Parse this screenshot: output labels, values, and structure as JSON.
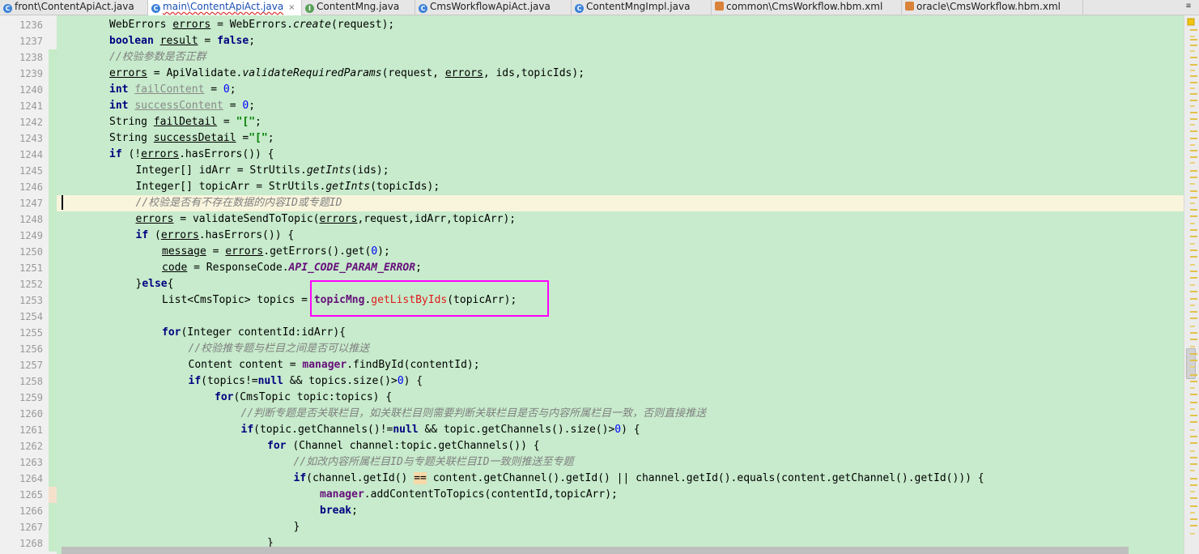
{
  "tabs": [
    {
      "label": "front\\ContentApiAct.java",
      "icon": "java-class-icon",
      "active": false,
      "underline": false
    },
    {
      "label": "main\\ContentApiAct.java",
      "icon": "java-class-icon",
      "active": true,
      "underline": true
    },
    {
      "label": "ContentMng.java",
      "icon": "java-interface-icon",
      "active": false,
      "underline": false
    },
    {
      "label": "CmsWorkflowApiAct.java",
      "icon": "java-class-icon",
      "active": false,
      "underline": false
    },
    {
      "label": "ContentMngImpl.java",
      "icon": "java-class-icon",
      "active": false,
      "underline": false
    },
    {
      "label": "common\\CmsWorkflow.hbm.xml",
      "icon": "xml-file-icon",
      "active": false,
      "underline": false
    },
    {
      "label": "oracle\\CmsWorkflow.hbm.xml",
      "icon": "xml-file-icon",
      "active": false,
      "underline": false
    }
  ],
  "tab_overflow_label": "≡",
  "editor": {
    "current_line": 1247,
    "highlighted_line": 1253,
    "lines": [
      {
        "num": "1236",
        "indent": 2,
        "tokens": [
          [
            "WebErrors ",
            ""
          ],
          [
            "errors",
            "ul"
          ],
          [
            " = WebErrors.",
            ""
          ],
          [
            "create",
            "it"
          ],
          [
            "(request);",
            ""
          ]
        ]
      },
      {
        "num": "1237",
        "indent": 2,
        "tokens": [
          [
            "boolean ",
            "kw"
          ],
          [
            "result",
            "ul"
          ],
          [
            " = ",
            ""
          ],
          [
            "false",
            "kw"
          ],
          [
            ";",
            ""
          ]
        ]
      },
      {
        "num": "1238",
        "indent": 2,
        "tokens": [
          [
            "//校验参数是否正群",
            "cm"
          ]
        ]
      },
      {
        "num": "1239",
        "indent": 2,
        "tokens": [
          [
            "errors",
            "ul"
          ],
          [
            " = ApiValidate.",
            ""
          ],
          [
            "validateRequiredParams",
            "it"
          ],
          [
            "(request, ",
            ""
          ],
          [
            "errors",
            "ul"
          ],
          [
            ", ids,topicIds);",
            ""
          ]
        ]
      },
      {
        "num": "1240",
        "indent": 2,
        "tokens": [
          [
            "int ",
            "kw"
          ],
          [
            "failContent",
            "unused"
          ],
          [
            " = ",
            ""
          ],
          [
            "0",
            "num"
          ],
          [
            ";",
            ""
          ]
        ]
      },
      {
        "num": "1241",
        "indent": 2,
        "tokens": [
          [
            "int ",
            "kw"
          ],
          [
            "successContent",
            "unused"
          ],
          [
            " = ",
            ""
          ],
          [
            "0",
            "num"
          ],
          [
            ";",
            ""
          ]
        ]
      },
      {
        "num": "1242",
        "indent": 2,
        "tokens": [
          [
            "String ",
            ""
          ],
          [
            "failDetail",
            "ul"
          ],
          [
            " = ",
            ""
          ],
          [
            "\"[\"",
            "str"
          ],
          [
            ";",
            ""
          ]
        ]
      },
      {
        "num": "1243",
        "indent": 2,
        "tokens": [
          [
            "String ",
            ""
          ],
          [
            "successDetail",
            "ul"
          ],
          [
            " =",
            ""
          ],
          [
            "\"[\"",
            "str"
          ],
          [
            ";",
            ""
          ]
        ]
      },
      {
        "num": "1244",
        "indent": 2,
        "tokens": [
          [
            "if ",
            "kw"
          ],
          [
            "(!",
            ""
          ],
          [
            "errors",
            "ul"
          ],
          [
            ".hasErrors()) {",
            ""
          ]
        ]
      },
      {
        "num": "1245",
        "indent": 3,
        "tokens": [
          [
            "Integer[] idArr = StrUtils.",
            ""
          ],
          [
            "getInts",
            "it"
          ],
          [
            "(ids);",
            ""
          ]
        ]
      },
      {
        "num": "1246",
        "indent": 3,
        "tokens": [
          [
            "Integer[] topicArr = StrUtils.",
            ""
          ],
          [
            "getInts",
            "it"
          ],
          [
            "(topicIds);",
            ""
          ]
        ]
      },
      {
        "num": "1247",
        "indent": 3,
        "tokens": [
          [
            "//校验是否有不存在数据的内容ID或专题ID",
            "cm"
          ]
        ]
      },
      {
        "num": "1248",
        "indent": 3,
        "tokens": [
          [
            "errors",
            "ul"
          ],
          [
            " = validateSendToTopic(",
            ""
          ],
          [
            "errors",
            "ul"
          ],
          [
            ",request,idArr,topicArr);",
            ""
          ]
        ]
      },
      {
        "num": "1249",
        "indent": 3,
        "tokens": [
          [
            "if ",
            "kw"
          ],
          [
            "(",
            ""
          ],
          [
            "errors",
            "ul"
          ],
          [
            ".hasErrors()) {",
            ""
          ]
        ]
      },
      {
        "num": "1250",
        "indent": 4,
        "tokens": [
          [
            "message",
            "ul"
          ],
          [
            " = ",
            ""
          ],
          [
            "errors",
            "ul"
          ],
          [
            ".getErrors().get(",
            ""
          ],
          [
            "0",
            "num"
          ],
          [
            ");",
            ""
          ]
        ]
      },
      {
        "num": "1251",
        "indent": 4,
        "tokens": [
          [
            "code",
            "ul"
          ],
          [
            " = ResponseCode.",
            ""
          ],
          [
            "API_CODE_PARAM_ERROR",
            "st"
          ],
          [
            ";",
            ""
          ]
        ]
      },
      {
        "num": "1252",
        "indent": 3,
        "tokens": [
          [
            "}",
            ""
          ],
          [
            "else",
            "kw"
          ],
          [
            "{",
            ""
          ]
        ]
      },
      {
        "num": "1253",
        "indent": 4,
        "tokens": [
          [
            "List<CmsTopic> topics = ",
            ""
          ],
          [
            "topicMng",
            "fld"
          ],
          [
            ".",
            ""
          ],
          [
            "getListByIds",
            "red"
          ],
          [
            "(topicArr);",
            ""
          ]
        ]
      },
      {
        "num": "1254",
        "indent": 0,
        "tokens": []
      },
      {
        "num": "1255",
        "indent": 4,
        "tokens": [
          [
            "for",
            "kw"
          ],
          [
            "(Integer contentId:idArr){",
            ""
          ]
        ]
      },
      {
        "num": "1256",
        "indent": 5,
        "tokens": [
          [
            "//校验推专题与栏目之间是否可以推送",
            "cm"
          ]
        ]
      },
      {
        "num": "1257",
        "indent": 5,
        "tokens": [
          [
            "Content content = ",
            ""
          ],
          [
            "manager",
            "fld"
          ],
          [
            ".findById(contentId);",
            ""
          ]
        ]
      },
      {
        "num": "1258",
        "indent": 5,
        "tokens": [
          [
            "if",
            "kw"
          ],
          [
            "(topics!=",
            ""
          ],
          [
            "null",
            "kw"
          ],
          [
            " && topics.size()>",
            ""
          ],
          [
            "0",
            "num"
          ],
          [
            ") {",
            ""
          ]
        ]
      },
      {
        "num": "1259",
        "indent": 6,
        "tokens": [
          [
            "for",
            "kw"
          ],
          [
            "(CmsTopic topic:topics) {",
            ""
          ]
        ]
      },
      {
        "num": "1260",
        "indent": 7,
        "tokens": [
          [
            "//判断专题是否关联栏目，如关联栏目则需要判断关联栏目是否与内容所属栏目一致，否则直接推送",
            "cm"
          ]
        ]
      },
      {
        "num": "1261",
        "indent": 7,
        "tokens": [
          [
            "if",
            "kw"
          ],
          [
            "(topic.getChannels()!=",
            ""
          ],
          [
            "null",
            "kw"
          ],
          [
            " && topic.getChannels().size()>",
            ""
          ],
          [
            "0",
            "num"
          ],
          [
            ") {",
            ""
          ]
        ]
      },
      {
        "num": "1262",
        "indent": 8,
        "tokens": [
          [
            "for ",
            "kw"
          ],
          [
            "(Channel channel:topic.getChannels()) {",
            ""
          ]
        ]
      },
      {
        "num": "1263",
        "indent": 9,
        "tokens": [
          [
            "//如改内容所属栏目ID与专题关联栏目ID一致则推送至专题",
            "cm"
          ]
        ]
      },
      {
        "num": "1264",
        "indent": 9,
        "tokens": [
          [
            "if",
            "kw"
          ],
          [
            "(channel.getId() ",
            ""
          ],
          [
            "==",
            "warn"
          ],
          [
            " content.getChannel().getId() || channel.getId().equals(content.getChannel().getId())) {",
            ""
          ]
        ]
      },
      {
        "num": "1265",
        "indent": 10,
        "tokens": [
          [
            "manager",
            "fld"
          ],
          [
            ".addContentToTopics(contentId,topicArr);",
            ""
          ]
        ]
      },
      {
        "num": "1266",
        "indent": 10,
        "tokens": [
          [
            "break",
            "kw"
          ],
          [
            ";",
            ""
          ]
        ]
      },
      {
        "num": "1267",
        "indent": 9,
        "tokens": [
          [
            "}",
            ""
          ]
        ]
      },
      {
        "num": "1268",
        "indent": 8,
        "tokens": [
          [
            "}",
            ""
          ]
        ]
      }
    ]
  },
  "annotation": {
    "color": "#ff00ff",
    "label": "highlight-box"
  },
  "colors": {
    "editor_bg": "#c7ebcc",
    "current_line_bg": "#f9f5dd",
    "keyword": "#000080",
    "comment": "#808080",
    "string": "#008000",
    "number": "#0000ff",
    "field": "#660e7a",
    "method_red": "#e01b1b",
    "gutter_bg": "#f0f0f0"
  }
}
